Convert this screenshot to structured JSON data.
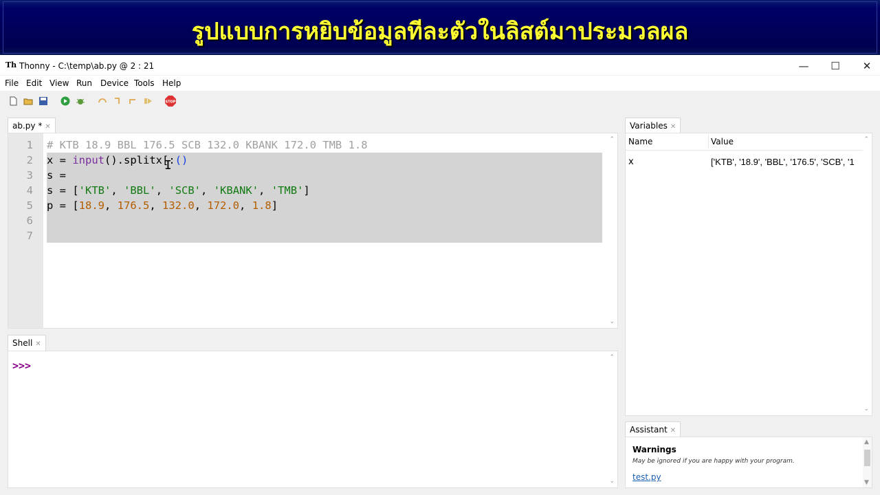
{
  "banner": {
    "title": "รูปแบบการหยิบข้อมูลทีละตัวในลิสต์มาประมวลผล"
  },
  "window": {
    "title": "Thonny  -  C:\\temp\\ab.py  @  2 : 21",
    "icon": "thonny-icon"
  },
  "menu": [
    "File",
    "Edit",
    "View",
    "Run",
    "Device",
    "Tools",
    "Help"
  ],
  "toolbar": [
    "new-file-icon",
    "open-file-icon",
    "save-file-icon",
    "run-icon",
    "debug-icon",
    "step-over-icon",
    "step-into-icon",
    "step-out-icon",
    "resume-icon",
    "stop-icon"
  ],
  "editor": {
    "tab_label": "ab.py *",
    "line_numbers": [
      "1",
      "2",
      "3",
      "4",
      "5",
      "6",
      "7"
    ],
    "line1": "# KTB 18.9 BBL 176.5 SCB 132.0 KBANK 172.0 TMB 1.8",
    "line2": {
      "a": "x = ",
      "b": "input",
      "c": "().split",
      "d": "x",
      "e": "[:",
      "f": "()"
    },
    "line3": "s = ",
    "line4": {
      "a": "s = [",
      "s1": "'KTB'",
      "c1": ", ",
      "s2": "'BBL'",
      "c2": ", ",
      "s3": "'SCB'",
      "c3": ", ",
      "s4": "'KBANK'",
      "c4": ", ",
      "s5": "'TMB'",
      "z": "]"
    },
    "line5": {
      "a": "p = [",
      "n1": "18.9",
      "c1": ", ",
      "n2": "176.5",
      "c2": ", ",
      "n3": "132.0",
      "c3": ", ",
      "n4": "172.0",
      "c4": ", ",
      "n5": "1.8",
      "z": "]"
    }
  },
  "shell": {
    "tab_label": "Shell",
    "prompt": ">>>"
  },
  "variables": {
    "tab_label": "Variables",
    "col_name": "Name",
    "col_value": "Value",
    "rows": [
      {
        "name": "x",
        "value": "['KTB', '18.9', 'BBL', '176.5', 'SCB', '1"
      }
    ]
  },
  "assistant": {
    "tab_label": "Assistant",
    "warnings_title": "Warnings",
    "warnings_sub": "May be ignored if you are happy with your program.",
    "link": "test.py"
  },
  "colors": {
    "banner_bg": "#000066",
    "banner_text": "#ffff33",
    "comment": "#a0a0a0",
    "builtin": "#7a2d9b",
    "string": "#127a12",
    "number": "#b35d00",
    "prompt": "#8b008b"
  }
}
